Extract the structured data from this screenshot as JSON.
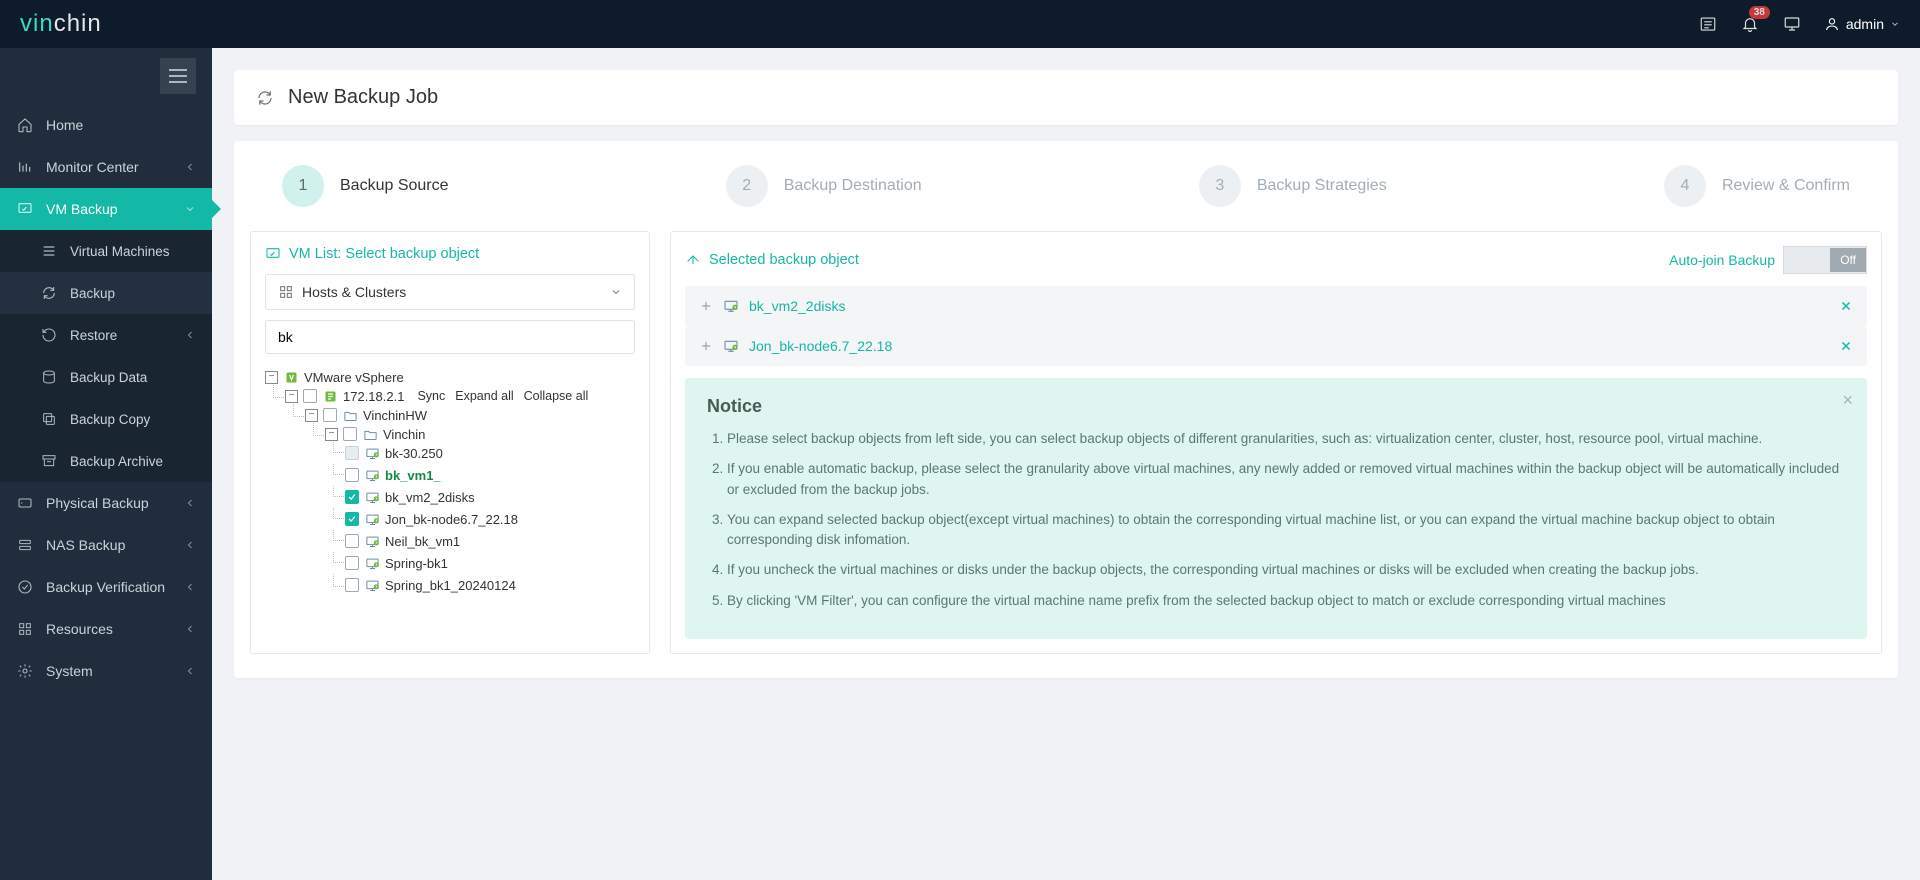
{
  "brand": {
    "vin": "vin",
    "chin": "chin"
  },
  "badge_count": "38",
  "user_name": "admin",
  "sidebar": {
    "hamburger": "menu",
    "items": [
      {
        "label": "Home",
        "icon": "home"
      },
      {
        "label": "Monitor Center",
        "icon": "chart",
        "caret": true
      },
      {
        "label": "VM Backup",
        "icon": "vm",
        "caret": true,
        "active": true
      },
      {
        "label": "Physical Backup",
        "icon": "disk",
        "caret": true
      },
      {
        "label": "NAS Backup",
        "icon": "nas",
        "caret": true
      },
      {
        "label": "Backup Verification",
        "icon": "verify",
        "caret": true
      },
      {
        "label": "Resources",
        "icon": "grid",
        "caret": true
      },
      {
        "label": "System",
        "icon": "gear",
        "caret": true
      }
    ],
    "sub_vm": [
      {
        "label": "Virtual Machines",
        "icon": "bars"
      },
      {
        "label": "Backup",
        "icon": "reload",
        "sel": true
      },
      {
        "label": "Restore",
        "icon": "restore",
        "caret": true
      },
      {
        "label": "Backup Data",
        "icon": "db"
      },
      {
        "label": "Backup Copy",
        "icon": "copy"
      },
      {
        "label": "Backup Archive",
        "icon": "archive"
      }
    ]
  },
  "page_title": "New Backup Job",
  "steps": [
    {
      "num": "1",
      "label": "Backup Source",
      "active": true
    },
    {
      "num": "2",
      "label": "Backup Destination"
    },
    {
      "num": "3",
      "label": "Backup Strategies"
    },
    {
      "num": "4",
      "label": "Review & Confirm"
    }
  ],
  "left_panel": {
    "title": "VM List: Select backup object",
    "dropdown_label": "Hosts & Clusters",
    "search_value": "bk",
    "actions": {
      "sync": "Sync",
      "expand": "Expand all",
      "collapse": "Collapse all"
    },
    "tree": {
      "root": "VMware vSphere",
      "host": "172.18.2.1",
      "dc": "VinchinHW",
      "cluster": "Vinchin",
      "vms": [
        {
          "name": "bk-30.250",
          "checked": false,
          "disabled": true
        },
        {
          "name": "bk_vm1_",
          "checked": false,
          "bold": true
        },
        {
          "name": "bk_vm2_2disks",
          "checked": true
        },
        {
          "name": "Jon_bk-node6.7_22.18",
          "checked": true
        },
        {
          "name": "Neil_bk_vm1",
          "checked": false
        },
        {
          "name": "Spring-bk1",
          "checked": false
        },
        {
          "name": "Spring_bk1_20240124",
          "checked": false
        }
      ]
    }
  },
  "right_panel": {
    "title": "Selected backup object",
    "autojoin_label": "Auto-join Backup",
    "toggle_off": "Off",
    "selected": [
      {
        "name": "bk_vm2_2disks"
      },
      {
        "name": "Jon_bk-node6.7_22.18"
      }
    ],
    "notice_title": "Notice",
    "notice_items": [
      "Please select backup objects from left side, you can select backup objects of different granularities, such as: virtualization center, cluster, host, resource pool, virtual machine.",
      "If you enable automatic backup, please select the granularity above virtual machines, any newly added or removed virtual machines within the backup object will be automatically included or excluded from the backup jobs.",
      "You can expand selected backup object(except virtual machines) to obtain the corresponding virtual machine list, or you can expand the virtual machine backup object to obtain corresponding disk infomation.",
      "If you uncheck the virtual machines or disks under the backup objects, the corresponding virtual machines or disks will be excluded when creating the backup jobs.",
      "By clicking 'VM Filter', you can configure the virtual machine name prefix from the selected backup object to match or exclude corresponding virtual machines"
    ]
  }
}
